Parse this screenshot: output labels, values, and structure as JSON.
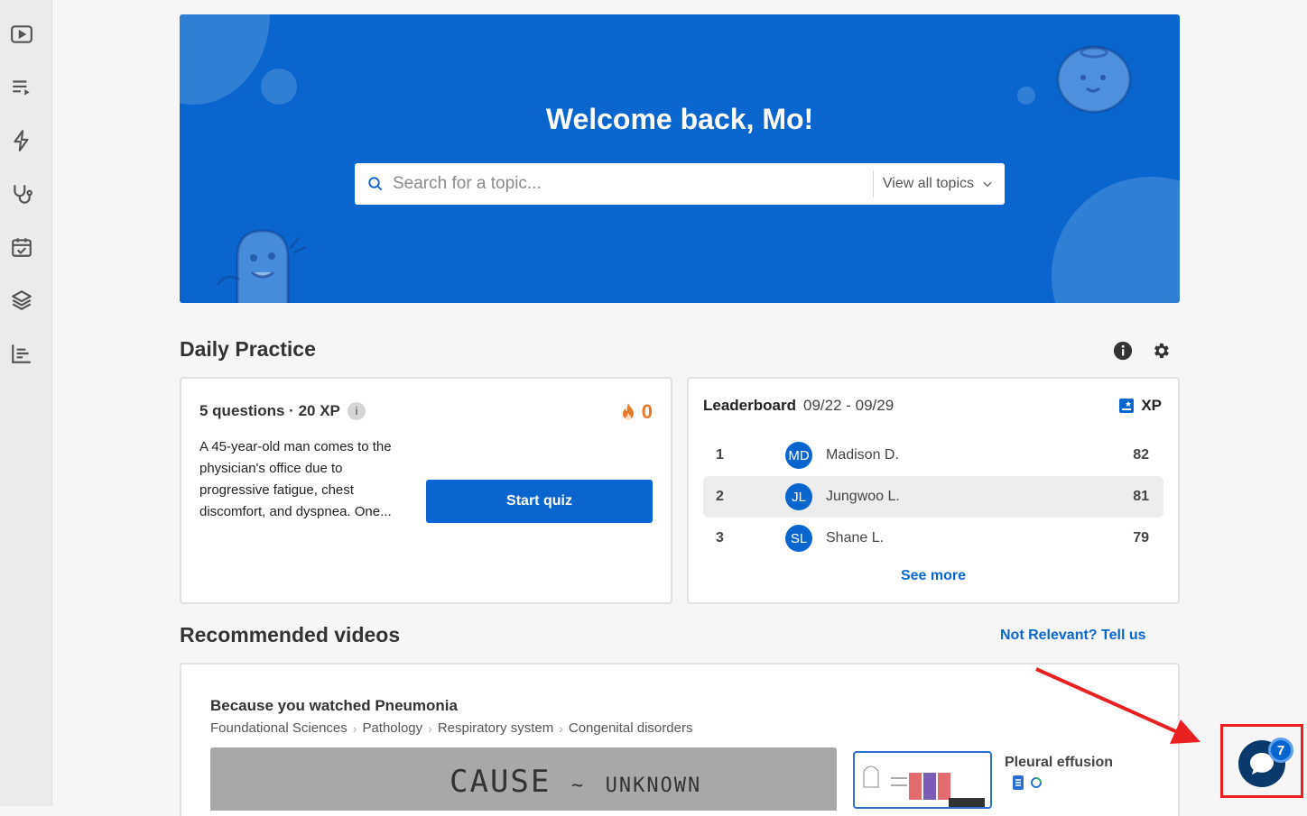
{
  "hero": {
    "title": "Welcome back, Mo!",
    "search_placeholder": "Search for a topic...",
    "topics_button": "View all topics"
  },
  "daily": {
    "title": "Daily Practice",
    "questions_label": "5 questions · 20 XP",
    "info_label": "i",
    "streak": "0",
    "question_text": "A 45-year-old man comes to the physician's office due to progressive fatigue, chest discomfort, and dyspnea. One...",
    "start_button": "Start quiz"
  },
  "leaderboard": {
    "title": "Leaderboard",
    "dates": "09/22 - 09/29",
    "xp_label": "XP",
    "rows": [
      {
        "rank": "1",
        "initials": "MD",
        "name": "Madison D.",
        "score": "82"
      },
      {
        "rank": "2",
        "initials": "JL",
        "name": "Jungwoo L.",
        "score": "81"
      },
      {
        "rank": "3",
        "initials": "SL",
        "name": "Shane L.",
        "score": "79"
      }
    ],
    "see_more": "See more"
  },
  "recommended": {
    "title": "Recommended videos",
    "not_relevant": "Not Relevant? Tell us",
    "subtitle": "Because you watched Pneumonia",
    "breadcrumbs": [
      "Foundational Sciences",
      "Pathology",
      "Respiratory system",
      "Congenital disorders"
    ],
    "thumb_text_main": "CAUSE",
    "thumb_text_tilde": "~",
    "thumb_text_small": "UNKNOWN",
    "video_title": "Pleural effusion"
  },
  "chat": {
    "badge": "7"
  },
  "colors": {
    "primary": "#0a66cf",
    "streak": "#e8792b",
    "annotation": "#e82020"
  },
  "sidebar_icons": [
    "video-play-icon",
    "playlist-icon",
    "lightning-icon",
    "stethoscope-icon",
    "calendar-check-icon",
    "layers-icon",
    "bar-chart-icon"
  ]
}
